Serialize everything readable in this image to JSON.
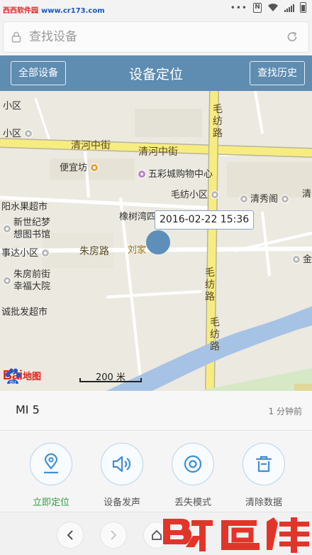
{
  "status_bar": {
    "watermark_cn": "西西软件园",
    "watermark_url": "www.cr173.com"
  },
  "search": {
    "placeholder": "查找设备"
  },
  "header": {
    "left_button": "全部设备",
    "title": "设备定位",
    "right_button": "查找历史"
  },
  "map": {
    "timestamp": "2016-02-22 15:36",
    "scale": "200 米",
    "brand": "Bai",
    "brand_suffix": "地图",
    "labels": {
      "community_top": "小区",
      "community_2": "小区",
      "qinghe_1": "清河中街",
      "qinghe_2": "清河中街",
      "bianyifang": "便宜坊",
      "wucai": "五彩城购物中心",
      "maofang_xiaoqu": "毛纺小区",
      "qingxiuge": "清秀阁",
      "qing_edge": "清",
      "fruit_market": "阳水果超市",
      "xiangshuwan": "橡树湾四",
      "xinshiji": "新世纪梦\n想图书馆",
      "shida": "事达小区",
      "zhufang_road": "朱房路",
      "liujia": "刘家",
      "zhufang_qianjie": "朱房前街\n幸福大院",
      "chengpi": "诚批发超市",
      "maofang_road_1": "毛纺路",
      "maofang_road_2": "毛纺路",
      "maofang_road_3": "毛纺路",
      "jin_edge": "金"
    }
  },
  "device": {
    "name": "MI 5",
    "last_seen": "1 分钟前"
  },
  "actions": [
    {
      "label": "立即定位",
      "icon": "location-pin-icon"
    },
    {
      "label": "设备发声",
      "icon": "speaker-icon"
    },
    {
      "label": "丢失模式",
      "icon": "target-icon"
    },
    {
      "label": "清除数据",
      "icon": "trash-icon"
    }
  ],
  "colors": {
    "header": "#5f8cb1",
    "accent_green": "#2f9d3e",
    "marker": "#5d8fb9",
    "baidu_red": "#e0241b",
    "logo_red": "#e3342a"
  }
}
